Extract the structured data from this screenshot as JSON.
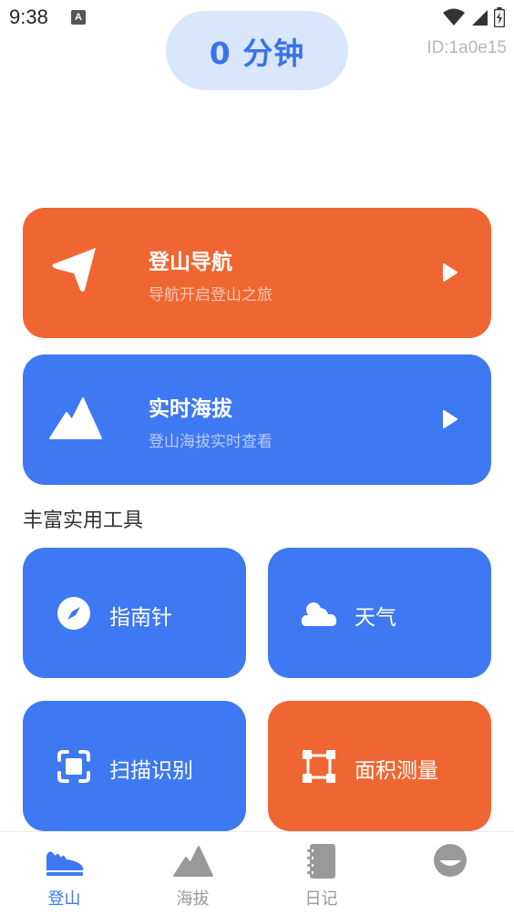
{
  "status_bar": {
    "time": "9:38",
    "app_icon": "A"
  },
  "header": {
    "timer": "0 分钟",
    "device_id": "ID:1a0e15"
  },
  "feature_cards": [
    {
      "title": "登山导航",
      "subtitle": "导航开启登山之旅",
      "icon": "navigation-arrow-icon",
      "color": "#f06632"
    },
    {
      "title": "实时海拔",
      "subtitle": "登山海拔实时查看",
      "icon": "mountain-icon",
      "color": "#3e78f2"
    }
  ],
  "tools_section": {
    "title": "丰富实用工具",
    "tools": [
      {
        "label": "指南针",
        "icon": "compass-icon",
        "color": "#3e78f2"
      },
      {
        "label": "天气",
        "icon": "cloud-icon",
        "color": "#3e78f2"
      },
      {
        "label": "扫描识别",
        "icon": "scan-icon",
        "color": "#3e78f2"
      },
      {
        "label": "面积测量",
        "icon": "area-measure-icon",
        "color": "#f06632"
      }
    ]
  },
  "bottom_nav": [
    {
      "label": "登山",
      "icon": "shoe-icon",
      "active": true
    },
    {
      "label": "海拔",
      "icon": "mountain-icon",
      "active": false
    },
    {
      "label": "日记",
      "icon": "notebook-icon",
      "active": false
    },
    {
      "label": "",
      "icon": "profile-icon",
      "active": false
    }
  ],
  "colors": {
    "accent_blue": "#3e78f2",
    "accent_orange": "#f06632",
    "timer_bg": "#d9e6fb",
    "inactive": "#9a9a9a"
  }
}
